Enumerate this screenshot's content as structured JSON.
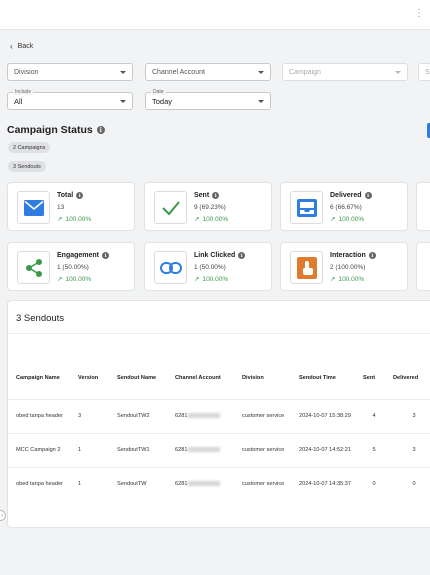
{
  "nav": {
    "back_label": "Back"
  },
  "filters": {
    "division_placeholder": "Division",
    "channel_account_placeholder": "Channel Account",
    "campaign_placeholder": "Campaign",
    "partial_placeholder": "S",
    "include_label": "Include",
    "include_value": "All",
    "date_label": "Date",
    "date_value": "Today"
  },
  "status": {
    "title": "Campaign Status",
    "chips": [
      "2 Campaigns",
      "3 Sendouts"
    ]
  },
  "metrics": [
    {
      "title": "Total",
      "value": "13",
      "pct": "100.00%",
      "icon": "envelope-icon"
    },
    {
      "title": "Sent",
      "value": "9 (69.23%)",
      "pct": "100.00%",
      "icon": "checkmark-icon"
    },
    {
      "title": "Delivered",
      "value": "6 (66.67%)",
      "pct": "100.00%",
      "icon": "inbox-tray-icon"
    },
    {
      "title": "Engagement",
      "value": "1 (50.00%)",
      "pct": "100.00%",
      "icon": "share-icon"
    },
    {
      "title": "Link Clicked",
      "value": "1 (50.00%)",
      "pct": "100.00%",
      "icon": "link-icon"
    },
    {
      "title": "Interaction",
      "value": "2 (100.00%)",
      "pct": "100.00%",
      "icon": "tap-hand-icon"
    }
  ],
  "sendouts": {
    "title": "3 Sendouts",
    "columns": [
      "Campaign Name",
      "Version",
      "Sendout Name",
      "Channel Account",
      "Division",
      "Sendout Time",
      "Sent",
      "Delivered"
    ],
    "rows": [
      {
        "campaign": "obed tanpa header",
        "version": "3",
        "sendout": "SendoutTW2",
        "account": "6281",
        "division": "customer service",
        "time": "2024-10-07 15:38:29",
        "sent": "4",
        "delivered": "3"
      },
      {
        "campaign": "MCC Campaign 2",
        "version": "1",
        "sendout": "SendoutTW1",
        "account": "6281",
        "division": "customer service",
        "time": "2024-10-07 14:52:21",
        "sent": "5",
        "delivered": "3"
      },
      {
        "campaign": "obed tanpa header",
        "version": "1",
        "sendout": "SendoutTW",
        "account": "6281",
        "division": "customer service",
        "time": "2024-10-07 14:35:37",
        "sent": "0",
        "delivered": "0"
      }
    ]
  },
  "colors": {
    "accent": "#2f7de0",
    "positive": "#3a9a4a",
    "envelope": "#2f7de0",
    "check": "#3a9a4a",
    "share": "#3a9a4a",
    "link": "#2f7de0",
    "interaction": "#e07a2f"
  }
}
